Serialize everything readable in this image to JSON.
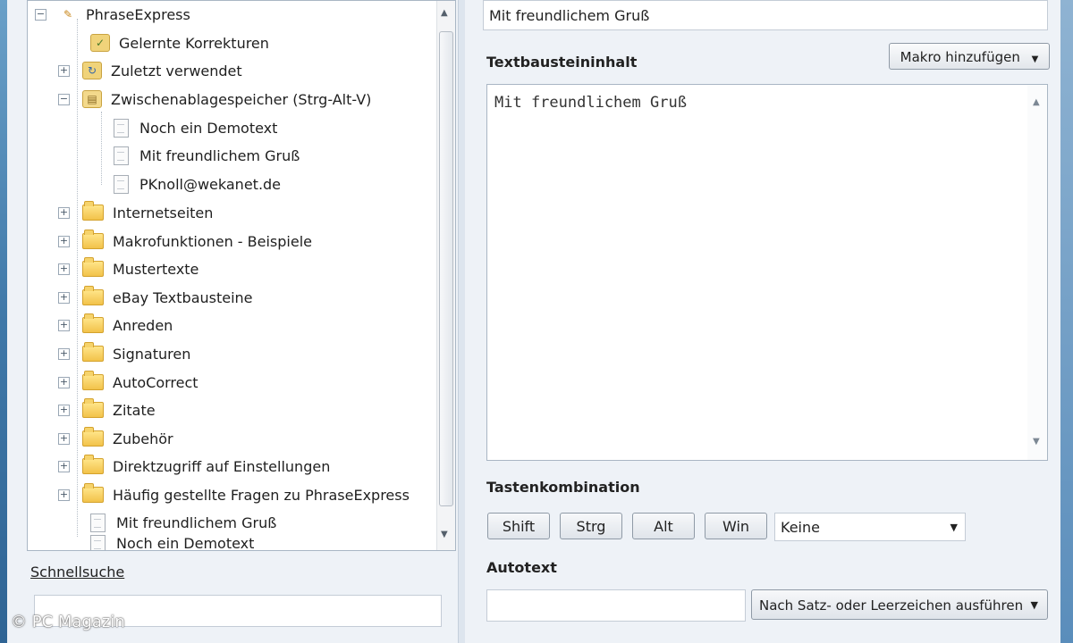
{
  "tree": {
    "root": "PhraseExpress",
    "items": [
      {
        "label": "Gelernte Korrekturen",
        "icon": "learned-corrections-icon"
      },
      {
        "label": "Zuletzt verwendet",
        "icon": "recent-icon"
      },
      {
        "label": "Zwischenablagespeicher (Strg-Alt-V)",
        "icon": "clipboard-icon"
      },
      {
        "label": "Noch ein Demotext",
        "icon": "document-icon"
      },
      {
        "label": "Mit freundlichem Gruß",
        "icon": "document-icon"
      },
      {
        "label": "PKnoll@wekanet.de",
        "icon": "document-icon"
      },
      {
        "label": "Internetseiten",
        "icon": "folder-icon"
      },
      {
        "label": "Makrofunktionen - Beispiele",
        "icon": "folder-icon"
      },
      {
        "label": "Mustertexte",
        "icon": "folder-icon"
      },
      {
        "label": "eBay Textbausteine",
        "icon": "folder-icon"
      },
      {
        "label": "Anreden",
        "icon": "folder-icon"
      },
      {
        "label": "Signaturen",
        "icon": "folder-icon"
      },
      {
        "label": "AutoCorrect",
        "icon": "folder-icon"
      },
      {
        "label": "Zitate",
        "icon": "folder-icon"
      },
      {
        "label": "Zubehör",
        "icon": "folder-icon"
      },
      {
        "label": "Direktzugriff auf Einstellungen",
        "icon": "folder-icon"
      },
      {
        "label": "Häufig gestellte Fragen zu PhraseExpress",
        "icon": "folder-icon"
      },
      {
        "label": "Mit freundlichem Gruß",
        "icon": "document-icon"
      },
      {
        "label": "Noch ein Demotext",
        "icon": "document-icon"
      }
    ]
  },
  "quick_search": {
    "label": "Schnellsuche",
    "value": ""
  },
  "watermark": "© PC Magazin",
  "phrase": {
    "description": "Mit freundlichem Gruß",
    "content_label": "Textbausteininhalt",
    "macro_button": "Makro hinzufügen",
    "content": "Mit freundlichem Gruß"
  },
  "hotkey": {
    "label": "Tastenkombination",
    "keys": [
      "Shift",
      "Strg",
      "Alt",
      "Win"
    ],
    "selected": "Keine"
  },
  "autotext": {
    "label": "Autotext",
    "value": "",
    "mode": "Nach Satz- oder Leerzeichen ausführen"
  }
}
